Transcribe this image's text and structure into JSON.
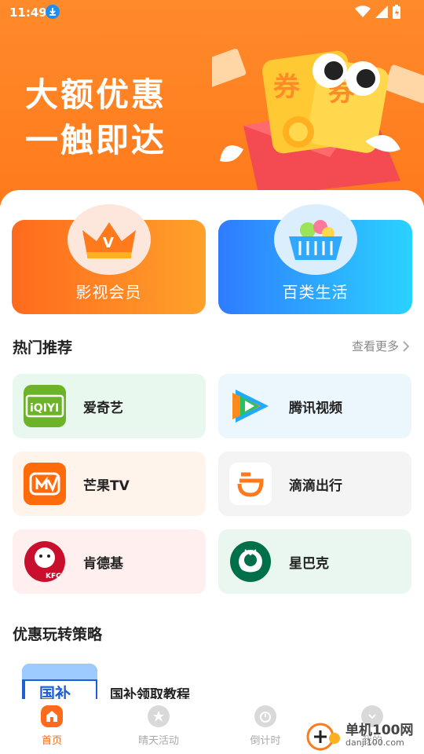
{
  "status_bar": {
    "time": "11:49"
  },
  "hero": {
    "line1": "大额优惠",
    "line2": "一触即达",
    "coupon_text": "券",
    "coupon_text2": "券"
  },
  "categories": [
    {
      "label": "影视会员",
      "badge_letter": "V"
    },
    {
      "label": "百类生活"
    }
  ],
  "hot": {
    "title": "热门推荐",
    "more": "查看更多",
    "items": [
      {
        "name": "爱奇艺",
        "logo_text": "iQIYI",
        "bg": "#e9f8ee"
      },
      {
        "name": "腾讯视频",
        "bg": "#ecf6fd"
      },
      {
        "name": "芒果TV",
        "bg": "#fff4ec"
      },
      {
        "name": "滴滴出行",
        "bg": "#f4f4f4"
      },
      {
        "name": "肯德基",
        "logo_text": "KFC",
        "bg": "#fff0ef"
      },
      {
        "name": "星巴克",
        "bg": "#eaf7f0"
      }
    ]
  },
  "strategy": {
    "title": "优惠玩转策略",
    "items": [
      {
        "label": "国补领取教程",
        "thumb_text": "国补"
      }
    ]
  },
  "tabbar": [
    {
      "label": "首页",
      "active": true
    },
    {
      "label": "晴天活动",
      "active": false
    },
    {
      "label": "倒计时",
      "active": false
    },
    {
      "label": "我的",
      "active": false
    }
  ],
  "watermark": {
    "title": "单机100网",
    "url": "danji100.com"
  },
  "colors": {
    "accent": "#ff6a1d",
    "blue": "#2f7cff"
  }
}
